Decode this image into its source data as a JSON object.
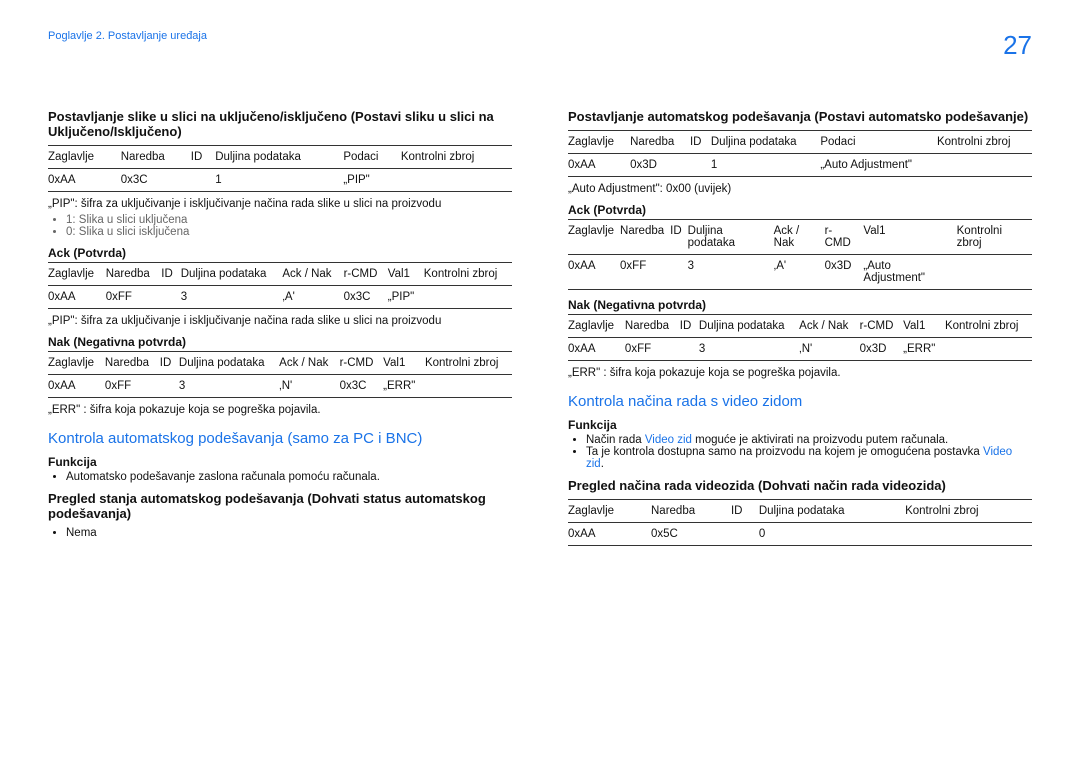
{
  "chapter": "Poglavlje 2. Postavljanje uređaja",
  "page_number": "27",
  "left": {
    "sec1_title": "Postavljanje slike u slici na uključeno/isključeno (Postavi sliku u slici na Uključeno/Isključeno)",
    "table1": {
      "h1": "Zaglavlje",
      "h2": "Naredba",
      "h3": "ID",
      "h4": "Duljina podataka",
      "h5": "Podaci",
      "h6": "Kontrolni zbroj",
      "r1c1": "0xAA",
      "r1c2": "0x3C",
      "r1c3": "",
      "r1c4": "1",
      "r1c5": "„PIP\"",
      "r1c6": ""
    },
    "pip_note": "„PIP\": šifra za uključivanje i isključivanje načina rada slike u slici na proizvodu",
    "pip_b1": "1: Slika u slici uključena",
    "pip_b2": "0: Slika u slici isključena",
    "ack_h": "Ack (Potvrda)",
    "table2": {
      "h1": "Zaglavlje",
      "h2": "Naredba",
      "h3": "ID",
      "h4": "Duljina podataka",
      "h5": "Ack / Nak",
      "h6": "r-CMD",
      "h7": "Val1",
      "h8": "Kontrolni zbroj",
      "r1c1": "0xAA",
      "r1c2": "0xFF",
      "r1c3": "",
      "r1c4": "3",
      "r1c5": "‚A'",
      "r1c6": "0x3C",
      "r1c7": "„PIP\"",
      "r1c8": ""
    },
    "pip_note2": "„PIP\": šifra za uključivanje i isključivanje načina rada slike u slici na proizvodu",
    "nak_h": "Nak (Negativna potvrda)",
    "table3": {
      "h1": "Zaglavlje",
      "h2": "Naredba",
      "h3": "ID",
      "h4": "Duljina podataka",
      "h5": "Ack / Nak",
      "h6": "r-CMD",
      "h7": "Val1",
      "h8": "Kontrolni zbroj",
      "r1c1": "0xAA",
      "r1c2": "0xFF",
      "r1c3": "",
      "r1c4": "3",
      "r1c5": "‚N'",
      "r1c6": "0x3C",
      "r1c7": "„ERR\"",
      "r1c8": ""
    },
    "err_note": "„ERR\" : šifra koja pokazuje koja se pogreška pojavila.",
    "blue_h": "Kontrola automatskog podešavanja (samo za PC i BNC)",
    "func_h": "Funkcija",
    "func_b1": "Automatsko podešavanje zaslona računala pomoću računala.",
    "preg_h": "Pregled stanja automatskog podešavanja (Dohvati status automatskog podešavanja)",
    "preg_b1": "Nema"
  },
  "right": {
    "sec1_title": "Postavljanje automatskog podešavanja (Postavi automatsko podešavanje)",
    "table1": {
      "h1": "Zaglavlje",
      "h2": "Naredba",
      "h3": "ID",
      "h4": "Duljina podataka",
      "h5": "Podaci",
      "h6": "Kontrolni zbroj",
      "r1c1": "0xAA",
      "r1c2": "0x3D",
      "r1c3": "",
      "r1c4": "1",
      "r1c5": "„Auto Adjustment\"",
      "r1c6": ""
    },
    "auto_note": "„Auto Adjustment\": 0x00 (uvijek)",
    "ack_h": "Ack (Potvrda)",
    "table2": {
      "h1": "Zaglavlje",
      "h2": "Naredba",
      "h3": "ID",
      "h4": "Duljina podataka",
      "h5": "Ack / Nak",
      "h6": "r-CMD",
      "h7": "Val1",
      "h8": "Kontrolni zbroj",
      "r1c1": "0xAA",
      "r1c2": "0xFF",
      "r1c3": "",
      "r1c4": "3",
      "r1c5": "‚A'",
      "r1c6": "0x3D",
      "r1c7": "„Auto Adjustment\"",
      "r1c8": ""
    },
    "nak_h": "Nak (Negativna potvrda)",
    "table3": {
      "h1": "Zaglavlje",
      "h2": "Naredba",
      "h3": "ID",
      "h4": "Duljina podataka",
      "h5": "Ack / Nak",
      "h6": "r-CMD",
      "h7": "Val1",
      "h8": "Kontrolni zbroj",
      "r1c1": "0xAA",
      "r1c2": "0xFF",
      "r1c3": "",
      "r1c4": "3",
      "r1c5": "‚N'",
      "r1c6": "0x3D",
      "r1c7": "„ERR\"",
      "r1c8": ""
    },
    "err_note": "„ERR\" : šifra koja pokazuje koja se pogreška pojavila.",
    "blue_h": "Kontrola načina rada s video zidom",
    "func_h": "Funkcija",
    "func_line1_pre": "Način rada ",
    "func_line1_blue": "Video zid",
    "func_line1_post": " moguće je aktivirati na proizvodu putem računala.",
    "func_line2_pre": "Ta je kontrola dostupna samo na proizvodu na kojem je omogućena postavka ",
    "func_line2_blue": "Video zid",
    "func_line2_post": ".",
    "preg_h": "Pregled načina rada videozida (Dohvati način rada videozida)",
    "table4": {
      "h1": "Zaglavlje",
      "h2": "Naredba",
      "h3": "ID",
      "h4": "Duljina podataka",
      "h5": "Kontrolni zbroj",
      "r1c1": "0xAA",
      "r1c2": "0x5C",
      "r1c3": "",
      "r1c4": "0",
      "r1c5": ""
    }
  }
}
